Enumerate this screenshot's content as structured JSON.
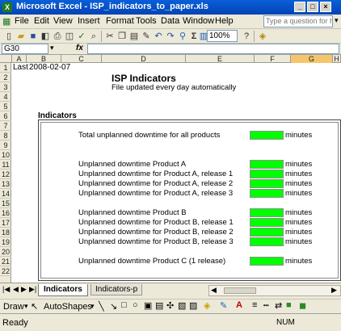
{
  "window": {
    "title": "Microsoft Excel - ISP_indicators_to_paper.xls",
    "app_icon": "X"
  },
  "menu": [
    "File",
    "Edit",
    "View",
    "Insert",
    "Format",
    "Tools",
    "Data",
    "Window",
    "Help"
  ],
  "help_search": {
    "placeholder": "Type a question for help"
  },
  "toolbar": {
    "zoom": "100%"
  },
  "formula_bar": {
    "name_box": "G30",
    "fx": "fx",
    "content": ""
  },
  "columns": [
    "A",
    "B",
    "C",
    "D",
    "E",
    "F",
    "G",
    "H"
  ],
  "rows": [
    "1",
    "2",
    "3",
    "4",
    "5",
    "6",
    "7",
    "8",
    "9",
    "10",
    "11",
    "12",
    "13",
    "14",
    "15",
    "16",
    "17",
    "18",
    "19",
    "20",
    "21",
    "22"
  ],
  "sheet": {
    "a1": "Last",
    "b1": "2008-02-07",
    "title": "ISP Indicators",
    "subtitle": "File updated every day automatically",
    "section": "Indicators",
    "indicators": [
      {
        "label": "Total unplanned downtime for all products",
        "unit": "minutes"
      },
      {
        "label": "Unplanned downtime Product A",
        "unit": "minutes"
      },
      {
        "label": "Unplanned downtime for Product A, release 1",
        "unit": "minutes"
      },
      {
        "label": "Unplanned downtime for Product A, release 2",
        "unit": "minutes"
      },
      {
        "label": "Unplanned downtime for Product A, release 3",
        "unit": "minutes"
      },
      {
        "label": "Unplanned downtime Product B",
        "unit": "minutes"
      },
      {
        "label": "Unplanned downtime for Product B, release 1",
        "unit": "minutes"
      },
      {
        "label": "Unplanned downtime for Product B, release 2",
        "unit": "minutes"
      },
      {
        "label": "Unplanned downtime for Product B, release 3",
        "unit": "minutes"
      },
      {
        "label": "Unplanned downtime Product C (1 release)",
        "unit": "minutes"
      }
    ],
    "indicator_fill": "#00ff00"
  },
  "sheet_tabs": [
    "Indicators",
    "Indicators-p"
  ],
  "drawbar": {
    "draw": "Draw",
    "autoshapes": "AutoShapes"
  },
  "status": {
    "left": "Ready",
    "right": "NUM"
  }
}
